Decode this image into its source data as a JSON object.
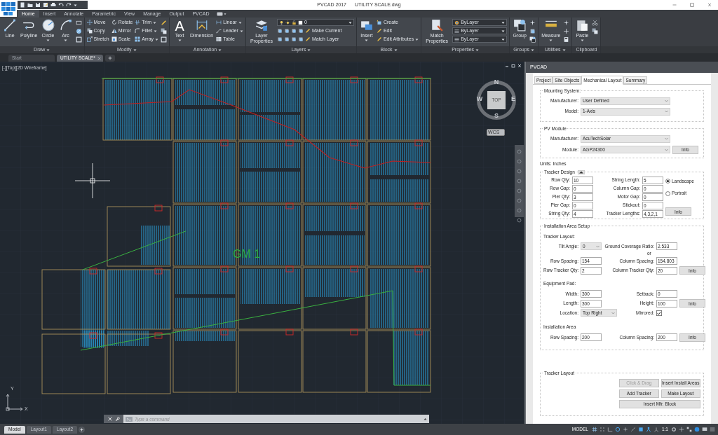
{
  "title_bar": {
    "app": "PVCAD 2017",
    "document": "UTILITY SCALE.dwg"
  },
  "ribbon": {
    "tabs": [
      {
        "label": "Home",
        "selected": true
      },
      {
        "label": "Insert",
        "selected": false
      },
      {
        "label": "Annotate",
        "selected": false
      },
      {
        "label": "Parametric",
        "selected": false
      },
      {
        "label": "View",
        "selected": false
      },
      {
        "label": "Manage",
        "selected": false
      },
      {
        "label": "Output",
        "selected": false
      },
      {
        "label": "PVCAD",
        "selected": false
      }
    ],
    "panels": [
      {
        "label": "Draw",
        "menu": true,
        "columns": [
          {
            "kind": "large",
            "label": "Line",
            "menu": false
          },
          {
            "kind": "large",
            "label": "Polyline",
            "menu": false
          },
          {
            "kind": "large",
            "label": "Circle",
            "menu": true
          },
          {
            "kind": "large",
            "label": "Arc",
            "menu": true
          }
        ]
      },
      {
        "label": "Modify",
        "menu": true,
        "columns": [
          {
            "kind": "stack",
            "items": [
              {
                "kind": "button",
                "label": "Move",
                "menu": false
              },
              {
                "kind": "button",
                "label": "Copy",
                "menu": false
              },
              {
                "kind": "button",
                "label": "Stretch",
                "menu": false
              }
            ]
          },
          {
            "kind": "stack",
            "items": [
              {
                "kind": "button",
                "label": "Rotate",
                "menu": false
              },
              {
                "kind": "button",
                "label": "Mirror",
                "menu": false
              },
              {
                "kind": "button",
                "label": "Scale",
                "menu": false
              }
            ]
          },
          {
            "kind": "stack",
            "items": [
              {
                "kind": "button",
                "label": "Trim",
                "menu": true
              },
              {
                "kind": "button",
                "label": "Fillet",
                "menu": true
              },
              {
                "kind": "button",
                "label": "Array",
                "menu": true
              }
            ]
          }
        ]
      },
      {
        "label": "Annotation",
        "menu": true,
        "columns": [
          {
            "kind": "large",
            "label": "Text",
            "icon_char": "A",
            "menu": true
          },
          {
            "kind": "large",
            "label": "Dimension",
            "menu": false
          },
          {
            "kind": "stack",
            "items": [
              {
                "kind": "button",
                "label": "Linear",
                "menu": true
              },
              {
                "kind": "button",
                "label": "Leader",
                "menu": true
              },
              {
                "kind": "button",
                "label": "Table",
                "menu": false
              }
            ]
          }
        ]
      },
      {
        "label": "Layers",
        "menu": true,
        "columns": [
          {
            "kind": "large",
            "label": "Layer Properties",
            "menu": false
          },
          {
            "kind": "stack",
            "items": [
              {
                "kind": "dropdown",
                "value": "0"
              },
              {
                "kind": "button",
                "label": "Make Current",
                "menu": false
              },
              {
                "kind": "button",
                "label": "Match Layer",
                "menu": false
              }
            ]
          }
        ]
      },
      {
        "label": "Block",
        "menu": true,
        "columns": [
          {
            "kind": "large",
            "label": "Insert",
            "menu": true
          },
          {
            "kind": "stack",
            "items": [
              {
                "kind": "button",
                "label": "Create",
                "menu": false
              },
              {
                "kind": "button",
                "label": "Edit",
                "menu": false
              },
              {
                "kind": "button",
                "label": "Edit Attributes",
                "menu": true
              }
            ]
          }
        ]
      },
      {
        "label": "Properties",
        "menu": true,
        "columns": [
          {
            "kind": "large",
            "label": "Match Properties",
            "menu": false
          },
          {
            "kind": "stack",
            "items": [
              {
                "kind": "dropdown",
                "value": "ByLayer"
              },
              {
                "kind": "dropdown",
                "value": "ByLayer"
              },
              {
                "kind": "dropdown",
                "value": "ByLayer"
              }
            ]
          }
        ]
      },
      {
        "label": "Groups",
        "menu": true,
        "columns": [
          {
            "kind": "large",
            "label": "Group",
            "menu": false
          }
        ]
      },
      {
        "label": "Utilities",
        "menu": true,
        "columns": [
          {
            "kind": "large",
            "label": "Measure",
            "menu": true
          }
        ]
      },
      {
        "label": "Clipboard",
        "menu": false,
        "columns": [
          {
            "kind": "large",
            "label": "Paste",
            "menu": true
          }
        ]
      }
    ]
  },
  "document_tabs": [
    {
      "label": "Start",
      "selected": false,
      "closable": false
    },
    {
      "label": "UTILITY SCALE*",
      "selected": true,
      "closable": true
    }
  ],
  "viewport": {
    "label": "[-][Top][2D Wireframe]",
    "viewcube": {
      "north": "N",
      "south": "S",
      "east": "E",
      "west": "W",
      "top": "TOP",
      "ucs": "WCS"
    },
    "area_label": "GM 1",
    "ucs_axes": [
      "X",
      "Y"
    ]
  },
  "command_line": {
    "placeholder": "Type a command"
  },
  "layout_tabs": [
    {
      "label": "Model",
      "selected": true
    },
    {
      "label": "Layout1",
      "selected": false
    },
    {
      "label": "Layout2",
      "selected": false
    }
  ],
  "status_bar": {
    "mode": "MODEL",
    "scale": "1:1"
  },
  "pvcad_panel": {
    "title": "PVCAD",
    "tabs": [
      {
        "label": "Project",
        "selected": false
      },
      {
        "label": "Site Objects",
        "selected": false
      },
      {
        "label": "Mechanical Layout",
        "selected": true
      },
      {
        "label": "Summary",
        "selected": false
      }
    ],
    "mounting_system": {
      "title": "Mounting System:",
      "fields": [
        {
          "label": "Manufacturer:",
          "value": "User Defined"
        },
        {
          "label": "Model:",
          "value": "1-Axis"
        }
      ]
    },
    "pv_module": {
      "title": "PV Module",
      "fields": [
        {
          "label": "Manufacturer:",
          "value": "AcuTechSolar"
        },
        {
          "label": "Module:",
          "value": "AGP24300"
        }
      ],
      "button": "Info"
    },
    "units": "Units: Inches",
    "tracker_design": {
      "title": "Tracker Design",
      "left_fields": [
        {
          "label": "Row Qty:",
          "value": "10"
        },
        {
          "label": "Row Gap:",
          "value": "0"
        },
        {
          "label": "Pier Qty:",
          "value": "3"
        },
        {
          "label": "Pier Gap:",
          "value": "0"
        },
        {
          "label": "String Qty:",
          "value": "4"
        }
      ],
      "right_fields": [
        {
          "label": "String Length:",
          "value": "5"
        },
        {
          "label": "Column Gap:",
          "value": "0"
        },
        {
          "label": "Motor Gap:",
          "value": "0"
        },
        {
          "label": "Stickout:",
          "value": "0"
        },
        {
          "label": "Tracker Lengths:",
          "value": "4,3,2,1"
        }
      ],
      "orientation": [
        {
          "label": "Landscape",
          "selected": true
        },
        {
          "label": "Portrait",
          "selected": false
        }
      ],
      "button": "Info"
    },
    "installation_area_setup": {
      "title": "Installation Area Setup",
      "tracker_layout": {
        "title": "Tracker Layout:",
        "tilt_angle": {
          "label": "Tilt Angle:",
          "value": "0"
        },
        "ground_coverage_ratio": {
          "label": "Ground Coverage Ratio:",
          "value": "2.533"
        },
        "or": "or",
        "row_spacing": {
          "label": "Row Spacing:",
          "value": "154"
        },
        "column_spacing": {
          "label": "Column Spacing:",
          "value": "154.803"
        },
        "row_tracker_qty": {
          "label": "Row Tracker Qty:",
          "value": "2"
        },
        "column_tracker_qty": {
          "label": "Column Tracker Qty:",
          "value": "20"
        },
        "button": "Info"
      },
      "equipment_pad": {
        "title": "Equipment Pad:",
        "width": {
          "label": "Width:",
          "value": "300"
        },
        "setback": {
          "label": "Setback:",
          "value": "0"
        },
        "length": {
          "label": "Length:",
          "value": "300"
        },
        "height": {
          "label": "Height:",
          "value": "100"
        },
        "button": "Info",
        "location": {
          "label": "Location:",
          "value": "Top Right"
        },
        "mirrored": {
          "label": "Mirrored:",
          "checked": true
        }
      },
      "installation_area": {
        "title": "Installation Area",
        "row_spacing": {
          "label": "Row Spacing:",
          "value": "200"
        },
        "column_spacing": {
          "label": "Column Spacing:",
          "value": "200"
        },
        "button": "Info"
      }
    },
    "tracker_layout": {
      "title": "Tracker Layout",
      "buttons": [
        {
          "label": "Click & Drag",
          "disabled": true
        },
        {
          "label": "Insert Install Areas",
          "disabled": false
        },
        {
          "label": "Add Tracker",
          "disabled": false
        },
        {
          "label": "Make Layout",
          "disabled": false
        },
        {
          "label": "Insert Mfr. Block",
          "disabled": false
        }
      ]
    }
  }
}
